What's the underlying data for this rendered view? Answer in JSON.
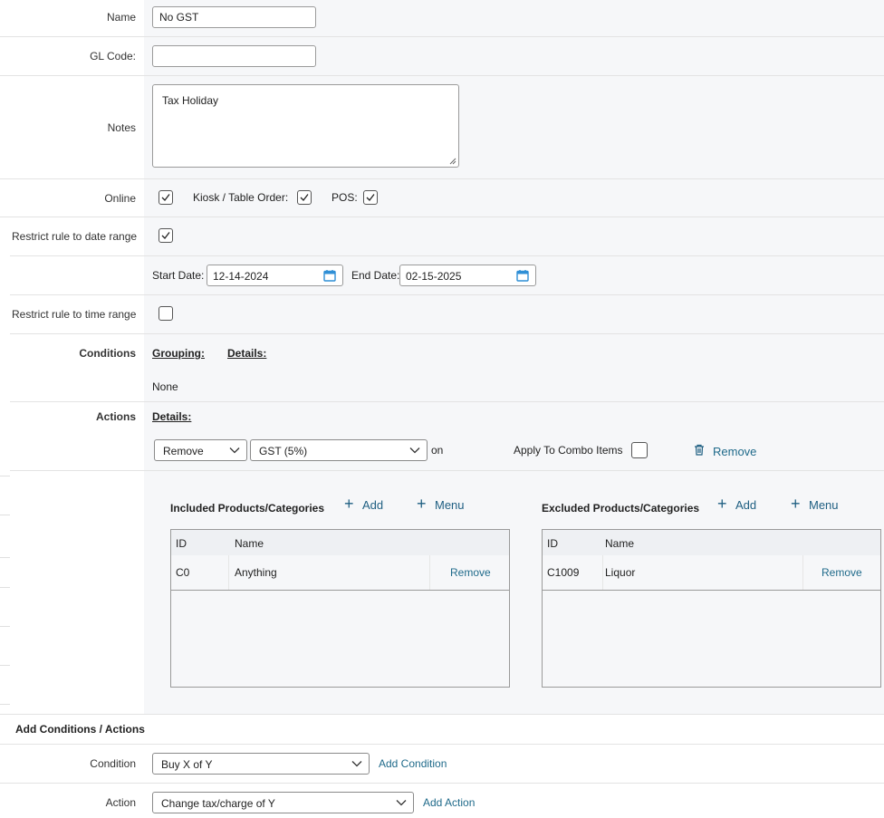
{
  "form": {
    "name_label": "Name",
    "name_value": "No GST",
    "glcode_label": "GL Code:",
    "glcode_value": "",
    "notes_label": "Notes",
    "notes_value": "Tax Holiday",
    "online_label": "Online",
    "online_checked": true,
    "kiosk_label": "Kiosk / Table Order:",
    "kiosk_checked": true,
    "pos_label": "POS:",
    "pos_checked": true,
    "restrict_date_label": "Restrict rule to date range",
    "restrict_date_checked": true,
    "start_date_label": "Start Date:",
    "start_date_value": "12-14-2024",
    "end_date_label": "End Date:",
    "end_date_value": "02-15-2025",
    "restrict_time_label": "Restrict rule to time range",
    "restrict_time_checked": false
  },
  "conditions": {
    "label": "Conditions",
    "grouping_label": "Grouping:",
    "details_label": "Details:",
    "value": "None"
  },
  "actions": {
    "label": "Actions",
    "details_label": "Details:",
    "action_select": "Remove",
    "tax_select": "GST (5%)",
    "on_label": "on",
    "apply_combo_label": "Apply To Combo Items",
    "apply_combo_checked": false,
    "remove_label": "Remove"
  },
  "included": {
    "title": "Included Products/Categories",
    "add_label": "Add",
    "menu_label": "Menu",
    "columns": [
      "ID",
      "Name"
    ],
    "rows": [
      {
        "id": "C0",
        "name": "Anything",
        "action": "Remove"
      }
    ]
  },
  "excluded": {
    "title": "Excluded Products/Categories",
    "add_label": "Add",
    "menu_label": "Menu",
    "columns": [
      "ID",
      "Name"
    ],
    "rows": [
      {
        "id": "C1009",
        "name": "Liquor",
        "action": "Remove"
      }
    ]
  },
  "add_section": {
    "title": "Add Conditions / Actions",
    "condition_label": "Condition",
    "condition_value": "Buy X of Y",
    "add_condition_label": "Add Condition",
    "action_label": "Action",
    "action_value": "Change tax/charge of Y",
    "add_action_label": "Add Action"
  },
  "colors": {
    "accent": "#1f6a8a",
    "panel": "#f6f7f9",
    "calendar_icon": "#2f8fd6"
  }
}
